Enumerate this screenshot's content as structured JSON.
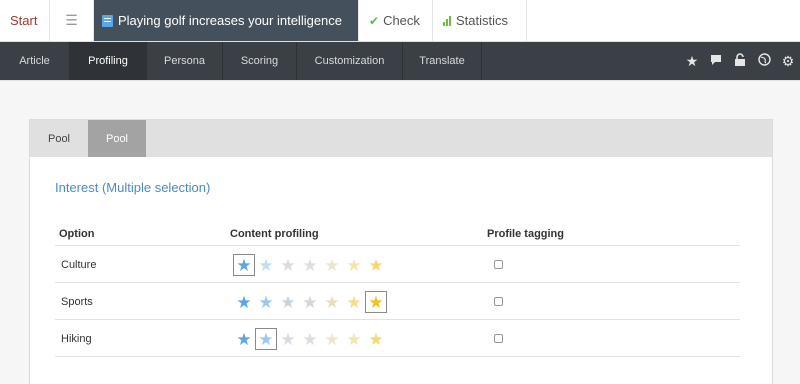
{
  "topbar": {
    "start": "Start",
    "list_icon": "list-icon",
    "doc_title": "Playing golf increases your intelligence",
    "check": "Check",
    "statistics": "Statistics"
  },
  "nav": {
    "items": [
      "Article",
      "Profiling",
      "Persona",
      "Scoring",
      "Customization",
      "Translate"
    ],
    "active": "Profiling",
    "icons": [
      "star-icon",
      "comment-icon",
      "unlock-icon",
      "globe-icon",
      "gear-icon"
    ]
  },
  "panel": {
    "tabs": [
      "Pool",
      "Pool"
    ],
    "active_tab": 1,
    "section_title": "Interest (Multiple selection)",
    "columns": {
      "option": "Option",
      "content_profiling": "Content profiling",
      "profile_tagging": "Profile tagging"
    },
    "rows": [
      {
        "label": "Culture",
        "selected_star": 1,
        "tagged": false
      },
      {
        "label": "Sports",
        "selected_star": 7,
        "tagged": false
      },
      {
        "label": "Hiking",
        "selected_star": 2,
        "tagged": false
      }
    ],
    "star_colors": [
      "#5aa6e6",
      "#9cc7ee",
      "#c6d3df",
      "#d6d6d6",
      "#e6dfbd",
      "#f0de8c",
      "#f3c320"
    ],
    "star_colors_dim": [
      "#a8cff2",
      "#c4dcf2",
      "#d6dde4",
      "#dedede",
      "#ece6cf",
      "#f2e6ad",
      "#f4d870"
    ]
  }
}
